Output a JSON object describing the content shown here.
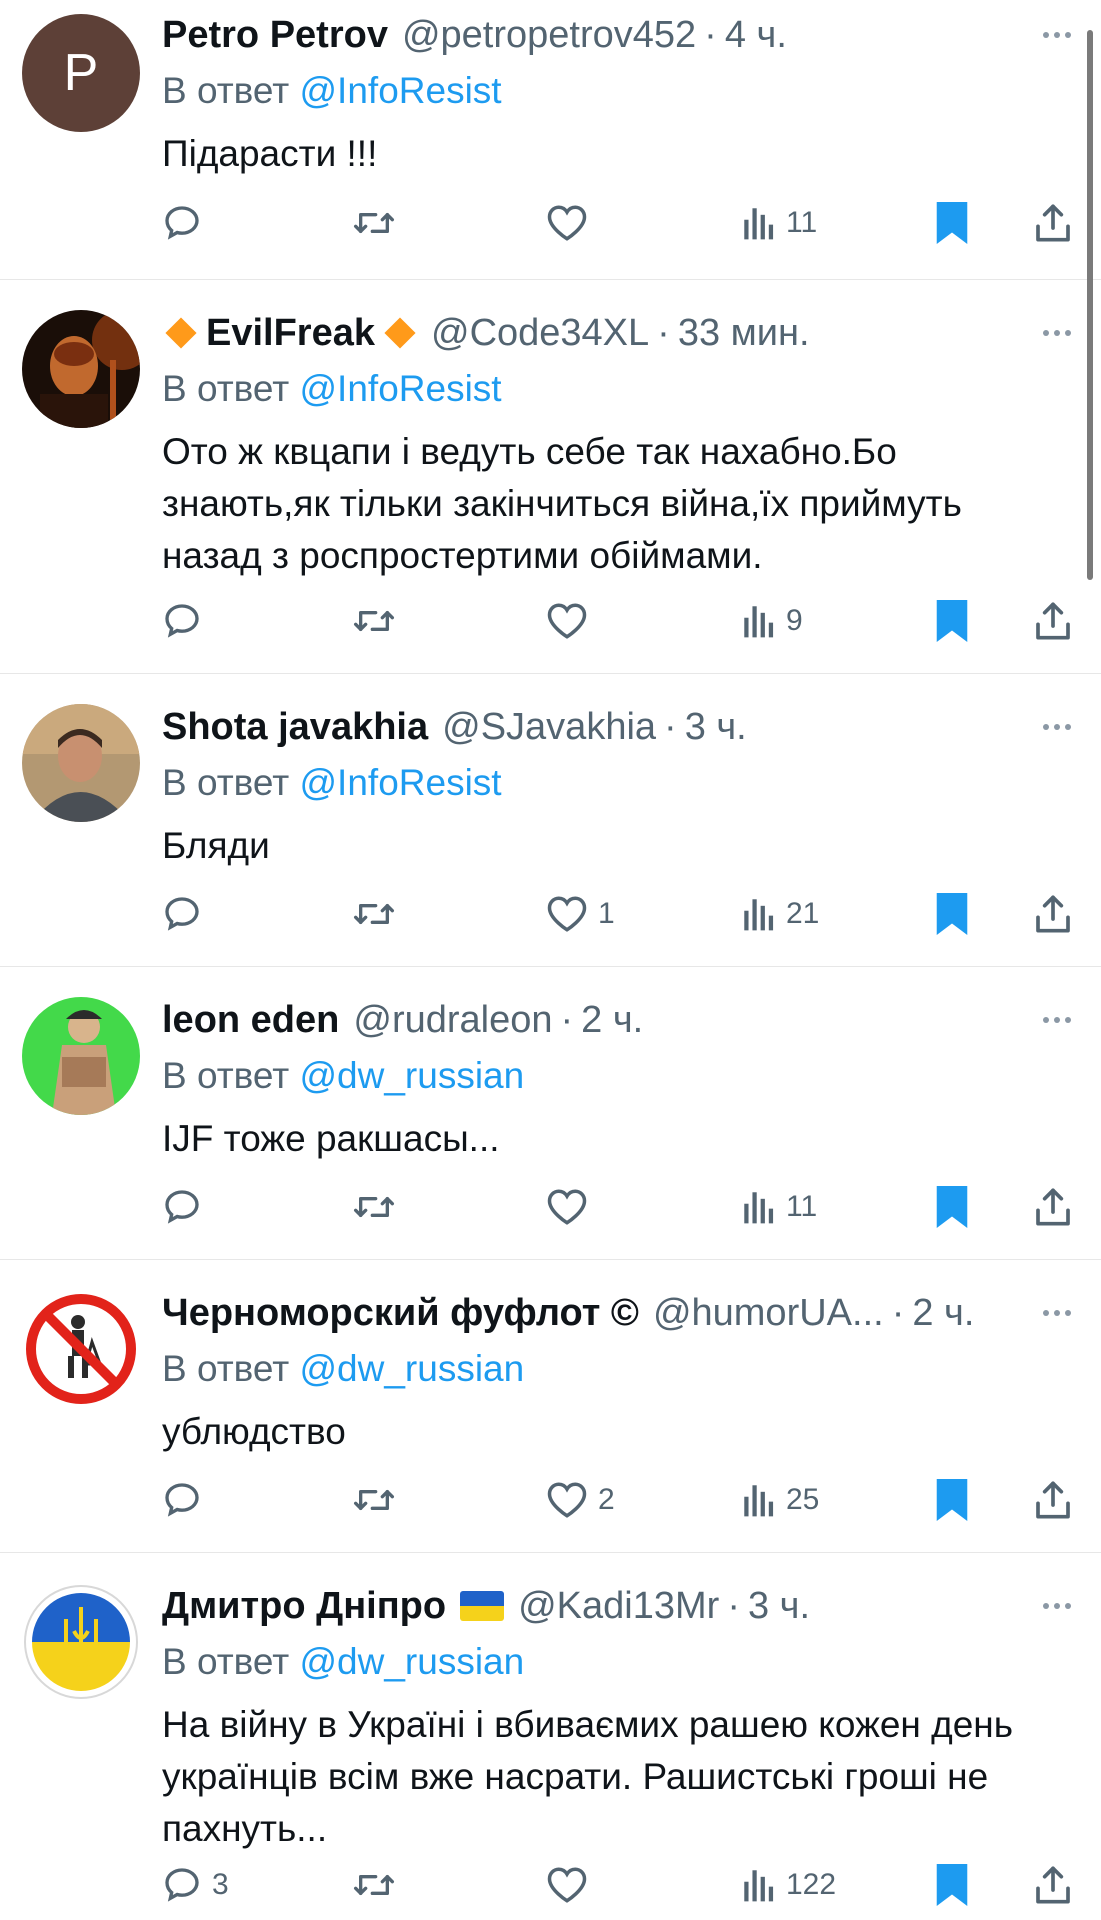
{
  "tweets": [
    {
      "name": "Petro Petrov",
      "handle": "@petropetrov452",
      "time": "4 ч.",
      "reply_label": "В ответ",
      "reply_to": "@InfoResist",
      "text": "Підарасти !!!",
      "replies": "",
      "likes": "",
      "views": "11",
      "avatar_letter": "P",
      "avatar_color": "#5d4037"
    },
    {
      "name": "EvilFreak",
      "handle": "@Code34XL",
      "time": "33 мин.",
      "reply_label": "В ответ",
      "reply_to": "@InfoResist",
      "text": "Ото ж квцапи і ведуть себе так нахабно.Бо знають,як тільки закінчиться війна,їх приймуть назад з роспростертими обіймами.",
      "replies": "",
      "likes": "",
      "views": "9"
    },
    {
      "name": "Shota javakhia",
      "handle": "@SJavakhia",
      "time": "3 ч.",
      "reply_label": "В ответ",
      "reply_to": "@InfoResist",
      "text": "Бляди",
      "replies": "",
      "likes": "1",
      "views": "21"
    },
    {
      "name": "leon eden",
      "handle": "@rudraleon",
      "time": "2 ч.",
      "reply_label": "В ответ",
      "reply_to": "@dw_russian",
      "text": "IJF тоже ракшасы...",
      "replies": "",
      "likes": "",
      "views": "11"
    },
    {
      "name": "Черноморский фуфлот ©",
      "handle": "@humorUA...",
      "time": "2 ч.",
      "reply_label": "В ответ",
      "reply_to": "@dw_russian",
      "text": "ублюдство",
      "replies": "",
      "likes": "2",
      "views": "25"
    },
    {
      "name": "Дмитро Дніпро",
      "handle": "@Kadi13Mr",
      "time": "3 ч.",
      "reply_label": "В ответ",
      "reply_to": "@dw_russian",
      "text": "На війну в Україні і вбиваємих рашею кожен день українців всім вже насрати. Рашистські гроші не пахнуть...",
      "replies": "3",
      "likes": "",
      "views": "122"
    }
  ],
  "colors": {
    "link": "#1d9bf0",
    "bookmark": "#1d9bf0",
    "secondary": "#536471"
  },
  "dot_separator": "·"
}
